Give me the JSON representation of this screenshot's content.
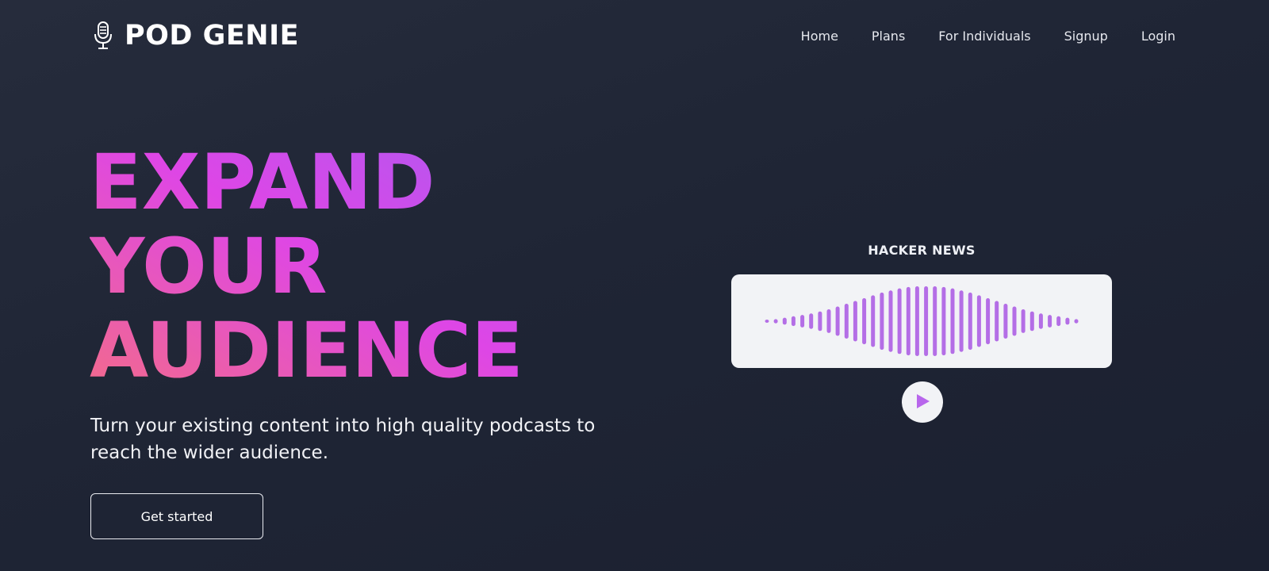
{
  "header": {
    "brand": "POD GENIE",
    "logo_icon": "microphone-icon",
    "nav": [
      {
        "label": "Home"
      },
      {
        "label": "Plans"
      },
      {
        "label": "For Individuals"
      },
      {
        "label": "Signup"
      },
      {
        "label": "Login"
      }
    ]
  },
  "hero": {
    "title_lines": [
      "EXPAND",
      "YOUR",
      "AUDIENCE"
    ],
    "subtitle": "Turn your existing content into high quality podcasts to reach the wider audience.",
    "cta_label": "Get started"
  },
  "player": {
    "label": "HACKER NEWS",
    "play_icon": "play-icon",
    "waveform_levels": [
      0.02,
      0.06,
      0.1,
      0.14,
      0.18,
      0.22,
      0.28,
      0.34,
      0.42,
      0.5,
      0.58,
      0.66,
      0.74,
      0.82,
      0.88,
      0.94,
      0.98,
      1.0,
      1.0,
      1.0,
      0.98,
      0.94,
      0.88,
      0.82,
      0.74,
      0.66,
      0.58,
      0.5,
      0.42,
      0.34,
      0.28,
      0.22,
      0.18,
      0.14,
      0.1,
      0.06
    ],
    "colors": {
      "wave": "#b46ee6",
      "play": "#b866ec",
      "card": "#f2f3f6"
    }
  },
  "colors": {
    "gradient_start": "#f26a8d",
    "gradient_mid": "#de46e6",
    "gradient_end": "#a65cf3"
  }
}
